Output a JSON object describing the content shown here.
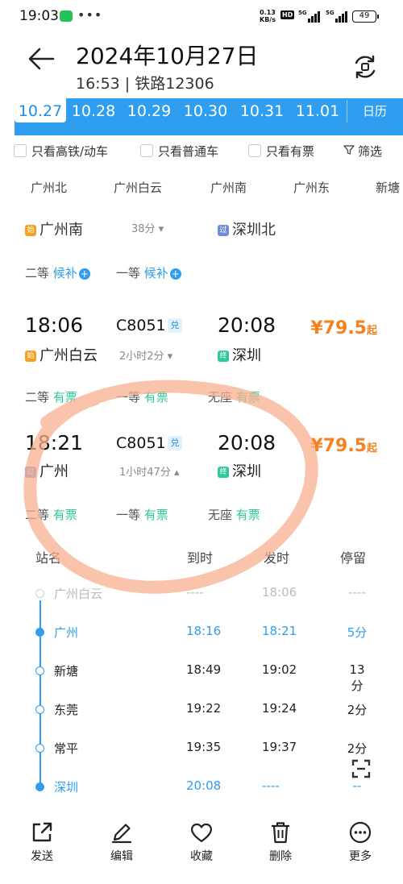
{
  "status_bar": {
    "time": "19:03",
    "dots": "•••",
    "speed_top": "0.13",
    "speed_bottom": "KB/s",
    "hd": "HD",
    "net1": "5G",
    "net2": "5G",
    "battery": "49"
  },
  "header": {
    "date": "2024年10月27日",
    "subtitle": "16:53 | 铁路12306"
  },
  "dates": {
    "tabs": [
      "10.27",
      "10.28",
      "10.29",
      "10.30",
      "10.31",
      "11.01"
    ],
    "calendar": "日历"
  },
  "filters": {
    "f1": "只看高铁/动车",
    "f2": "只看普通车",
    "f3": "只看有票",
    "screen": "筛选"
  },
  "stations": [
    "广州北",
    "广州白云",
    "广州南",
    "广州东",
    "新塘"
  ],
  "cut_row": {
    "start_tag": "始",
    "from": "广州南",
    "duration": "38分 ▾",
    "via_tag": "过",
    "to": "深圳北",
    "seat1_name": "二等",
    "seat1_status": "候补",
    "seat2_name": "一等",
    "seat2_status": "候补"
  },
  "trains": [
    {
      "dep_time": "18:06",
      "dep_tag": "始",
      "dep_station": "广州白云",
      "train_no": "C8051",
      "badge": "兑",
      "duration": "2小时2分 ▾",
      "arr_time": "20:08",
      "arr_tag": "终",
      "arr_station": "深圳",
      "price": "¥79.5",
      "price_suffix": "起",
      "seats": [
        {
          "name": "二等",
          "status": "有票"
        },
        {
          "name": "一等",
          "status": "有票"
        },
        {
          "name": "无座",
          "status": "有票"
        }
      ]
    },
    {
      "dep_time": "18:21",
      "dep_tag": "过",
      "dep_station": "广州",
      "train_no": "C8051",
      "badge": "兑",
      "duration": "1小时47分 ▴",
      "arr_time": "20:08",
      "arr_tag": "终",
      "arr_station": "深圳",
      "price": "¥79.5",
      "price_suffix": "起",
      "seats": [
        {
          "name": "二等",
          "status": "有票"
        },
        {
          "name": "一等",
          "status": "有票"
        },
        {
          "name": "无座",
          "status": "有票"
        }
      ]
    }
  ],
  "stops_header": {
    "station": "站名",
    "arrive": "到时",
    "depart": "发时",
    "stay": "停留"
  },
  "stops": [
    {
      "name": "广州白云",
      "arrive": "----",
      "depart": "18:06",
      "stay": "----"
    },
    {
      "name": "广州",
      "arrive": "18:16",
      "depart": "18:21",
      "stay": "5分"
    },
    {
      "name": "新塘",
      "arrive": "18:49",
      "depart": "19:02",
      "stay": "13分"
    },
    {
      "name": "东莞",
      "arrive": "19:22",
      "depart": "19:24",
      "stay": "2分"
    },
    {
      "name": "常平",
      "arrive": "19:35",
      "depart": "19:37",
      "stay": "2分"
    },
    {
      "name": "深圳",
      "arrive": "20:08",
      "depart": "----",
      "stay": "--"
    }
  ],
  "bottom_bar": {
    "send": "发送",
    "edit": "编辑",
    "favorite": "收藏",
    "delete": "删除",
    "more": "更多"
  },
  "colors": {
    "accent": "#2f9ef0",
    "price": "#f4821f",
    "available": "#2fc79c",
    "annotation": "#f7b08f"
  }
}
